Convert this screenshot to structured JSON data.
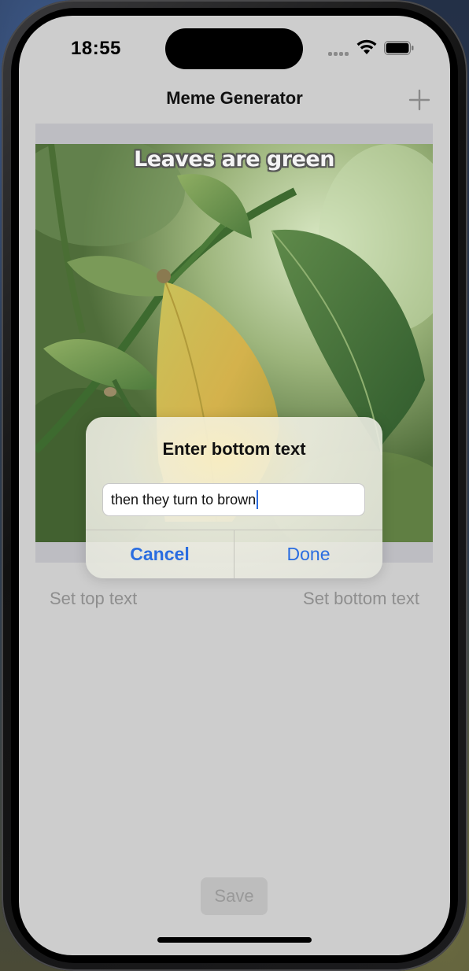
{
  "status_bar": {
    "time": "18:55"
  },
  "nav": {
    "title": "Meme Generator",
    "add_icon": "plus-icon"
  },
  "meme": {
    "top_text": "Leaves are green",
    "image_description_icon": "leaf-photo"
  },
  "actions": {
    "set_top_label": "Set top text",
    "set_bottom_label": "Set bottom text",
    "save_label": "Save"
  },
  "alert": {
    "title": "Enter bottom text",
    "input_value": "then they turn to brown",
    "cancel_label": "Cancel",
    "done_label": "Done"
  },
  "colors": {
    "accent": "#2a6de0",
    "screen_bg": "#cdcdcd",
    "disabled_text": "#8e8e8e"
  }
}
